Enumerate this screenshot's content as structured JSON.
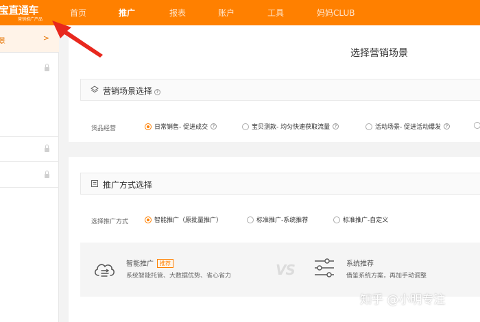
{
  "app": {
    "logo_text": "宝直通车",
    "logo_subtitle": "营销推广产品"
  },
  "nav": {
    "items": [
      {
        "label": "首页"
      },
      {
        "label": "推广"
      },
      {
        "label": "报表"
      },
      {
        "label": "账户"
      },
      {
        "label": "工具"
      },
      {
        "label": "妈妈CLUB"
      }
    ],
    "active": "推广"
  },
  "sidebar": {
    "items": [
      {
        "label": "景",
        "state": "active",
        "icon": "chevron-right-icon"
      },
      {
        "label": "",
        "state": "locked",
        "icon": "lock-icon"
      },
      {
        "label": "",
        "state": "locked",
        "icon": "lock-icon"
      },
      {
        "label": "",
        "state": "locked",
        "icon": "lock-icon"
      }
    ]
  },
  "page": {
    "title": "选择营销场景"
  },
  "scene_section": {
    "title": "营销场景选择",
    "row_label": "货品经营",
    "options": [
      {
        "label": "日常销售- 促进成交",
        "checked": true
      },
      {
        "label": "宝贝测款- 均匀快速获取流量",
        "checked": false
      },
      {
        "label": "活动场景- 促进活动爆发",
        "checked": false
      },
      {
        "label": "",
        "checked": false
      }
    ]
  },
  "method_section": {
    "title": "推广方式选择",
    "row_label": "选择推广方式",
    "options": [
      {
        "label": "智能推广（原批量推广）",
        "checked": true
      },
      {
        "label": "标准推广-系统推荐",
        "checked": false
      },
      {
        "label": "标准推广-自定义",
        "checked": false
      }
    ]
  },
  "compare": {
    "left": {
      "title": "智能推广",
      "badge": "推荐",
      "desc": "系统智能托管、大数据优势、省心省力",
      "icon": "cloud-flow-icon"
    },
    "vs": "VS",
    "right": {
      "title": "系统推荐",
      "desc": "借鉴系统方案，再加手动调整",
      "icon": "sliders-icon"
    }
  },
  "watermark": {
    "text": "知乎 @小明专注"
  },
  "colors": {
    "brand": "#ff8000",
    "annotation_arrow": "#e8281e"
  }
}
